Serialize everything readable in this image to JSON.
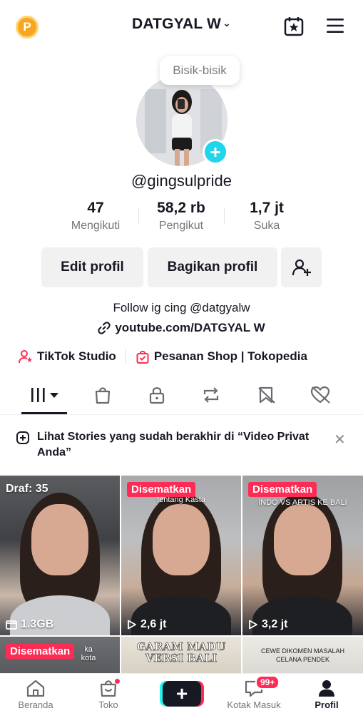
{
  "header": {
    "username": "DATGYAL W",
    "coin_letter": "P"
  },
  "profile": {
    "bubble_text": "Bisik-bisik",
    "handle": "@gingsulpride",
    "stats": [
      {
        "value": "47",
        "label": "Mengikuti"
      },
      {
        "value": "58,2 rb",
        "label": "Pengikut"
      },
      {
        "value": "1,7 jt",
        "label": "Suka"
      }
    ],
    "buttons": {
      "edit": "Edit profil",
      "share": "Bagikan profil"
    },
    "bio": "Follow ig cing @datgyalw",
    "link": "youtube.com/DATGYAL W",
    "tools": {
      "studio": "TikTok Studio",
      "shop": "Pesanan Shop | Tokopedia"
    }
  },
  "tabs": [
    "videos-grid-icon",
    "shop-bag-icon",
    "lock-icon",
    "repost-icon",
    "favorites-icon",
    "liked-icon"
  ],
  "notice": {
    "text": "Lihat Stories yang sudah berakhir di “Video Privat Anda”"
  },
  "videos": [
    {
      "draft": "Draf: 35",
      "stat": "1.3GB"
    },
    {
      "pinned": "Disematkan",
      "caption": "anya\ntentang Kasta",
      "stat": "2,6 jt"
    },
    {
      "pinned": "Disematkan",
      "caption": "RAH DI\nINDO VS ARTIS KE BALI",
      "stat": "3,2 jt"
    },
    {
      "pinned": "Disematkan",
      "caption": "ka\nkota"
    },
    {
      "banner": "GARAM MADU\nVERSI BALI"
    },
    {
      "caption": "CEWE DIKOMEN MASALAH\nCELANA PENDEK"
    }
  ],
  "bottom_nav": {
    "home": "Beranda",
    "shop": "Toko",
    "inbox": "Kotak Masuk",
    "inbox_badge": "99+",
    "profile": "Profil"
  },
  "colors": {
    "accent_red": "#fe2c55",
    "accent_cyan": "#20d5ec",
    "coin": "#f5a623"
  }
}
